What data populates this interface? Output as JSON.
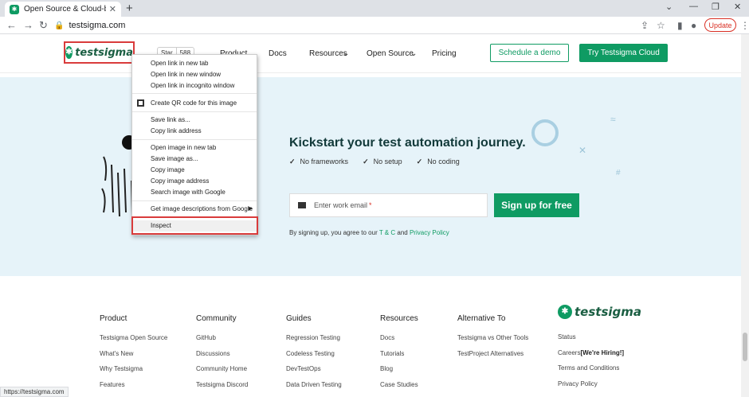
{
  "browser": {
    "tab_title": "Open Source & Cloud-based Tes",
    "url": "testsigma.com",
    "update_label": "Update",
    "status_url": "https://testsigma.com"
  },
  "header": {
    "logo_text": "testsigma",
    "gh_star": "Star",
    "gh_count": "588",
    "nav": [
      "Product",
      "Docs",
      "Resources",
      "Open Source",
      "Pricing"
    ],
    "demo_label": "Schedule a demo",
    "try_label": "Try Testsigma Cloud"
  },
  "hero": {
    "title": "Kickstart your test automation journey.",
    "checks": [
      "No frameworks",
      "No setup",
      "No coding"
    ],
    "email_placeholder": "Enter work email",
    "required_mark": "*",
    "signup_label": "Sign up for free",
    "terms_prefix": "By signing up, you agree to our",
    "terms_tc": "T & C",
    "terms_and": "and",
    "terms_privacy": "Privacy Policy"
  },
  "context_menu": {
    "items": [
      "Open link in new tab",
      "Open link in new window",
      "Open link in incognito window",
      "Create QR code for this image",
      "Save link as...",
      "Copy link address",
      "Open image in new tab",
      "Save image as...",
      "Copy image",
      "Copy image address",
      "Search image with Google",
      "Get image descriptions from Google",
      "Inspect"
    ]
  },
  "footer": {
    "columns": [
      {
        "title": "Product",
        "items": [
          "Testsigma Open Source",
          "What's New",
          "Why Testsigma",
          "Features"
        ]
      },
      {
        "title": "Community",
        "items": [
          "GitHub",
          "Discussions",
          "Community Home",
          "Testsigma Discord"
        ]
      },
      {
        "title": "Guides",
        "items": [
          "Regression Testing",
          "Codeless Testing",
          "DevTestOps",
          "Data Driven Testing"
        ]
      },
      {
        "title": "Resources",
        "items": [
          "Docs",
          "Tutorials",
          "Blog",
          "Case Studies"
        ]
      },
      {
        "title": "Alternative To",
        "items": [
          "Testsigma vs Other Tools",
          "TestProject Alternatives"
        ]
      }
    ],
    "logo_text": "testsigma",
    "right_items": [
      "Status",
      "Careers",
      "Terms and Conditions",
      "Privacy Policy"
    ],
    "hiring": "[We're Hiring!]"
  }
}
